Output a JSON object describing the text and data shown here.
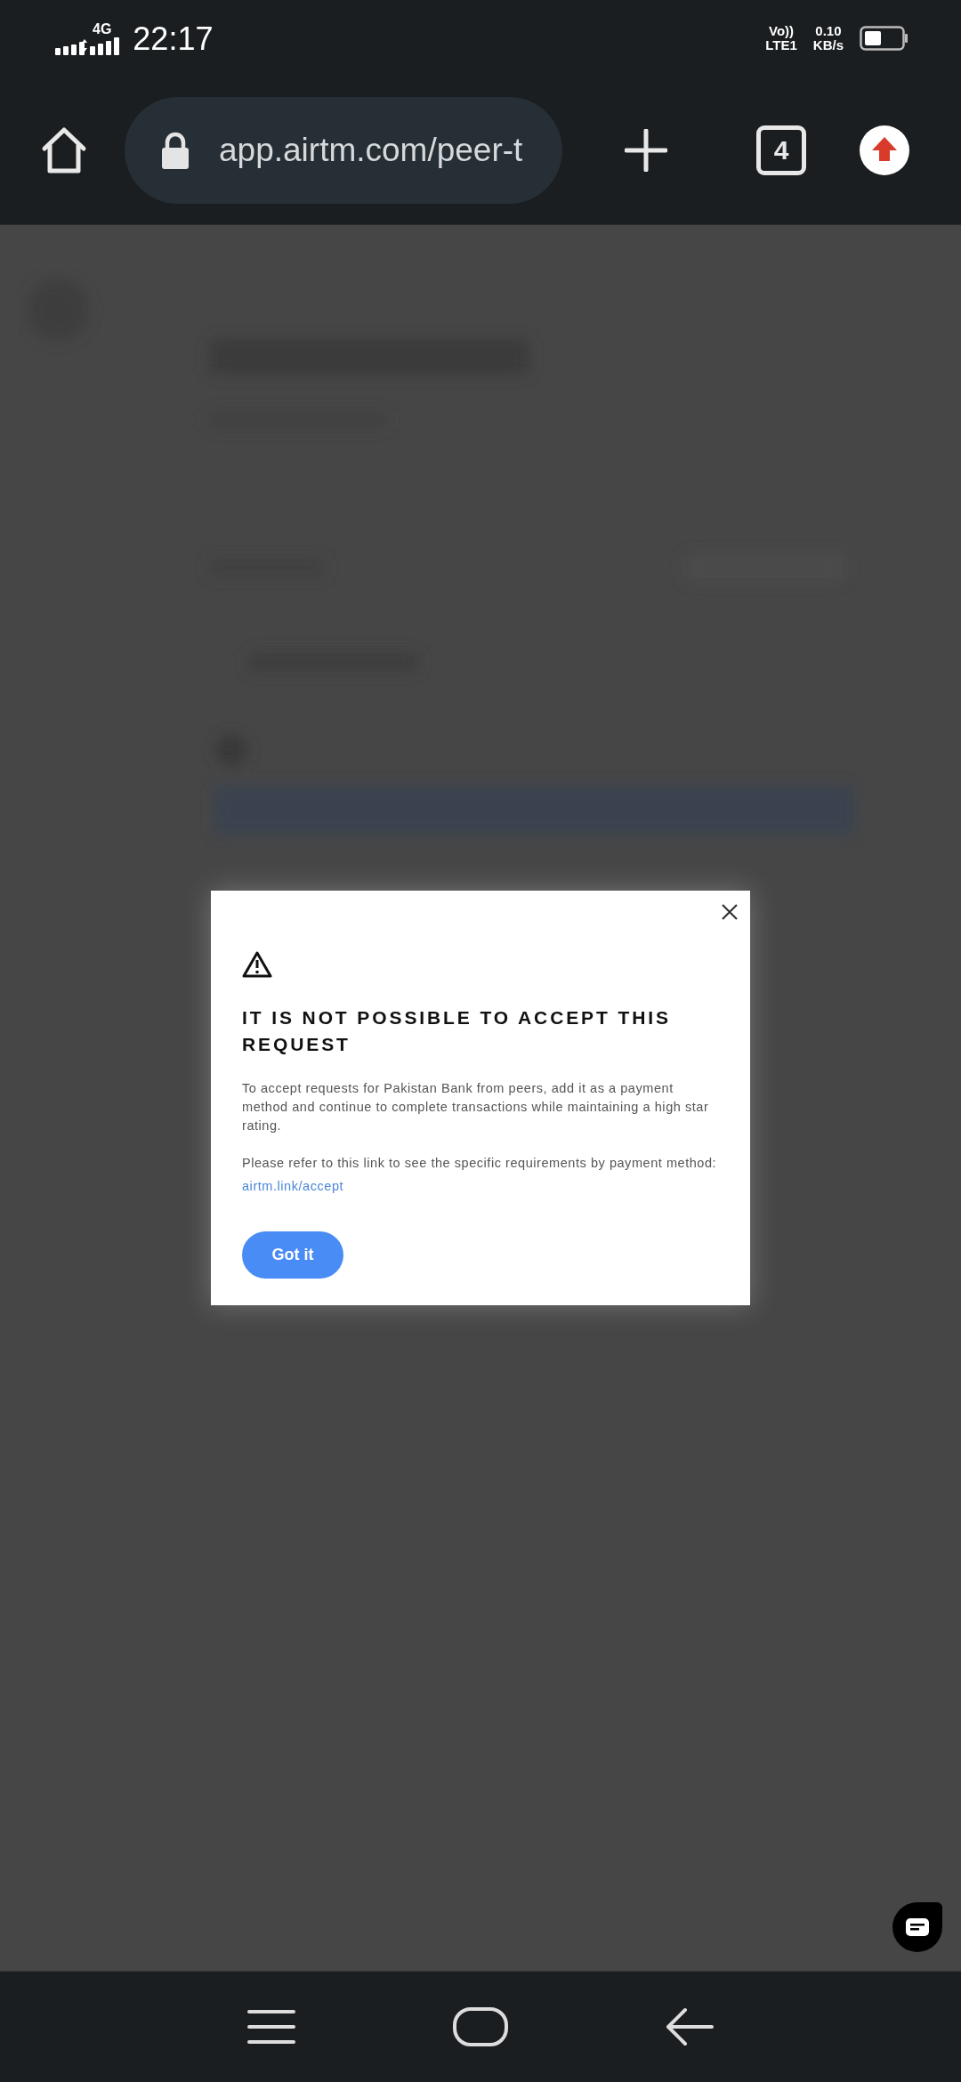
{
  "status_bar": {
    "network": "4G",
    "time": "22:17",
    "volte": "Vo))",
    "lte": "LTE1",
    "speed_value": "0.10",
    "speed_unit": "KB/s"
  },
  "browser_bar": {
    "url": "app.airtm.com/peer-t",
    "tab_count": "4"
  },
  "dialog": {
    "title": "IT IS NOT POSSIBLE TO ACCEPT THIS REQUEST",
    "message": "To accept requests for Pakistan Bank from peers, add it as a payment method and continue to complete transactions while maintaining a high star rating.",
    "link_text": "Please refer to this link to see the specific requirements by payment method: ",
    "link": "airtm.link/accept",
    "button": "Got it"
  }
}
